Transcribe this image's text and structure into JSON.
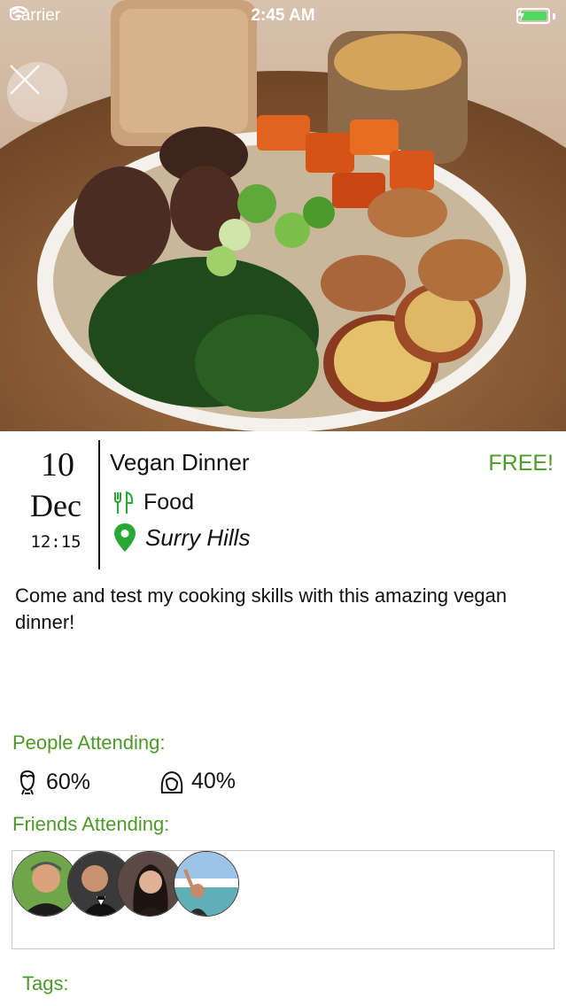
{
  "status_bar": {
    "carrier": "Carrier",
    "time": "2:45 AM",
    "battery_color": "#4cd964"
  },
  "hero": {
    "icon": "food-photo",
    "close_icon": "close-icon"
  },
  "event": {
    "day": "10",
    "month": "Dec",
    "time": "12:15",
    "title": "Vegan Dinner",
    "price": "FREE!",
    "category": "Food",
    "category_icon": "fork-knife-icon",
    "location": "Surry Hills",
    "location_icon": "map-pin-icon",
    "description": "Come and test my cooking skills with this amazing vegan dinner!"
  },
  "attendance": {
    "label": "People Attending:",
    "male_percent": "60%",
    "female_percent": "40%"
  },
  "friends": {
    "label": "Friends Attending:",
    "avatars": [
      "friend-1",
      "friend-2",
      "friend-3",
      "friend-4"
    ]
  },
  "tags": {
    "label": "Tags:"
  },
  "colors": {
    "accent_green": "#4c9a28",
    "pin_green": "#2aa836"
  }
}
